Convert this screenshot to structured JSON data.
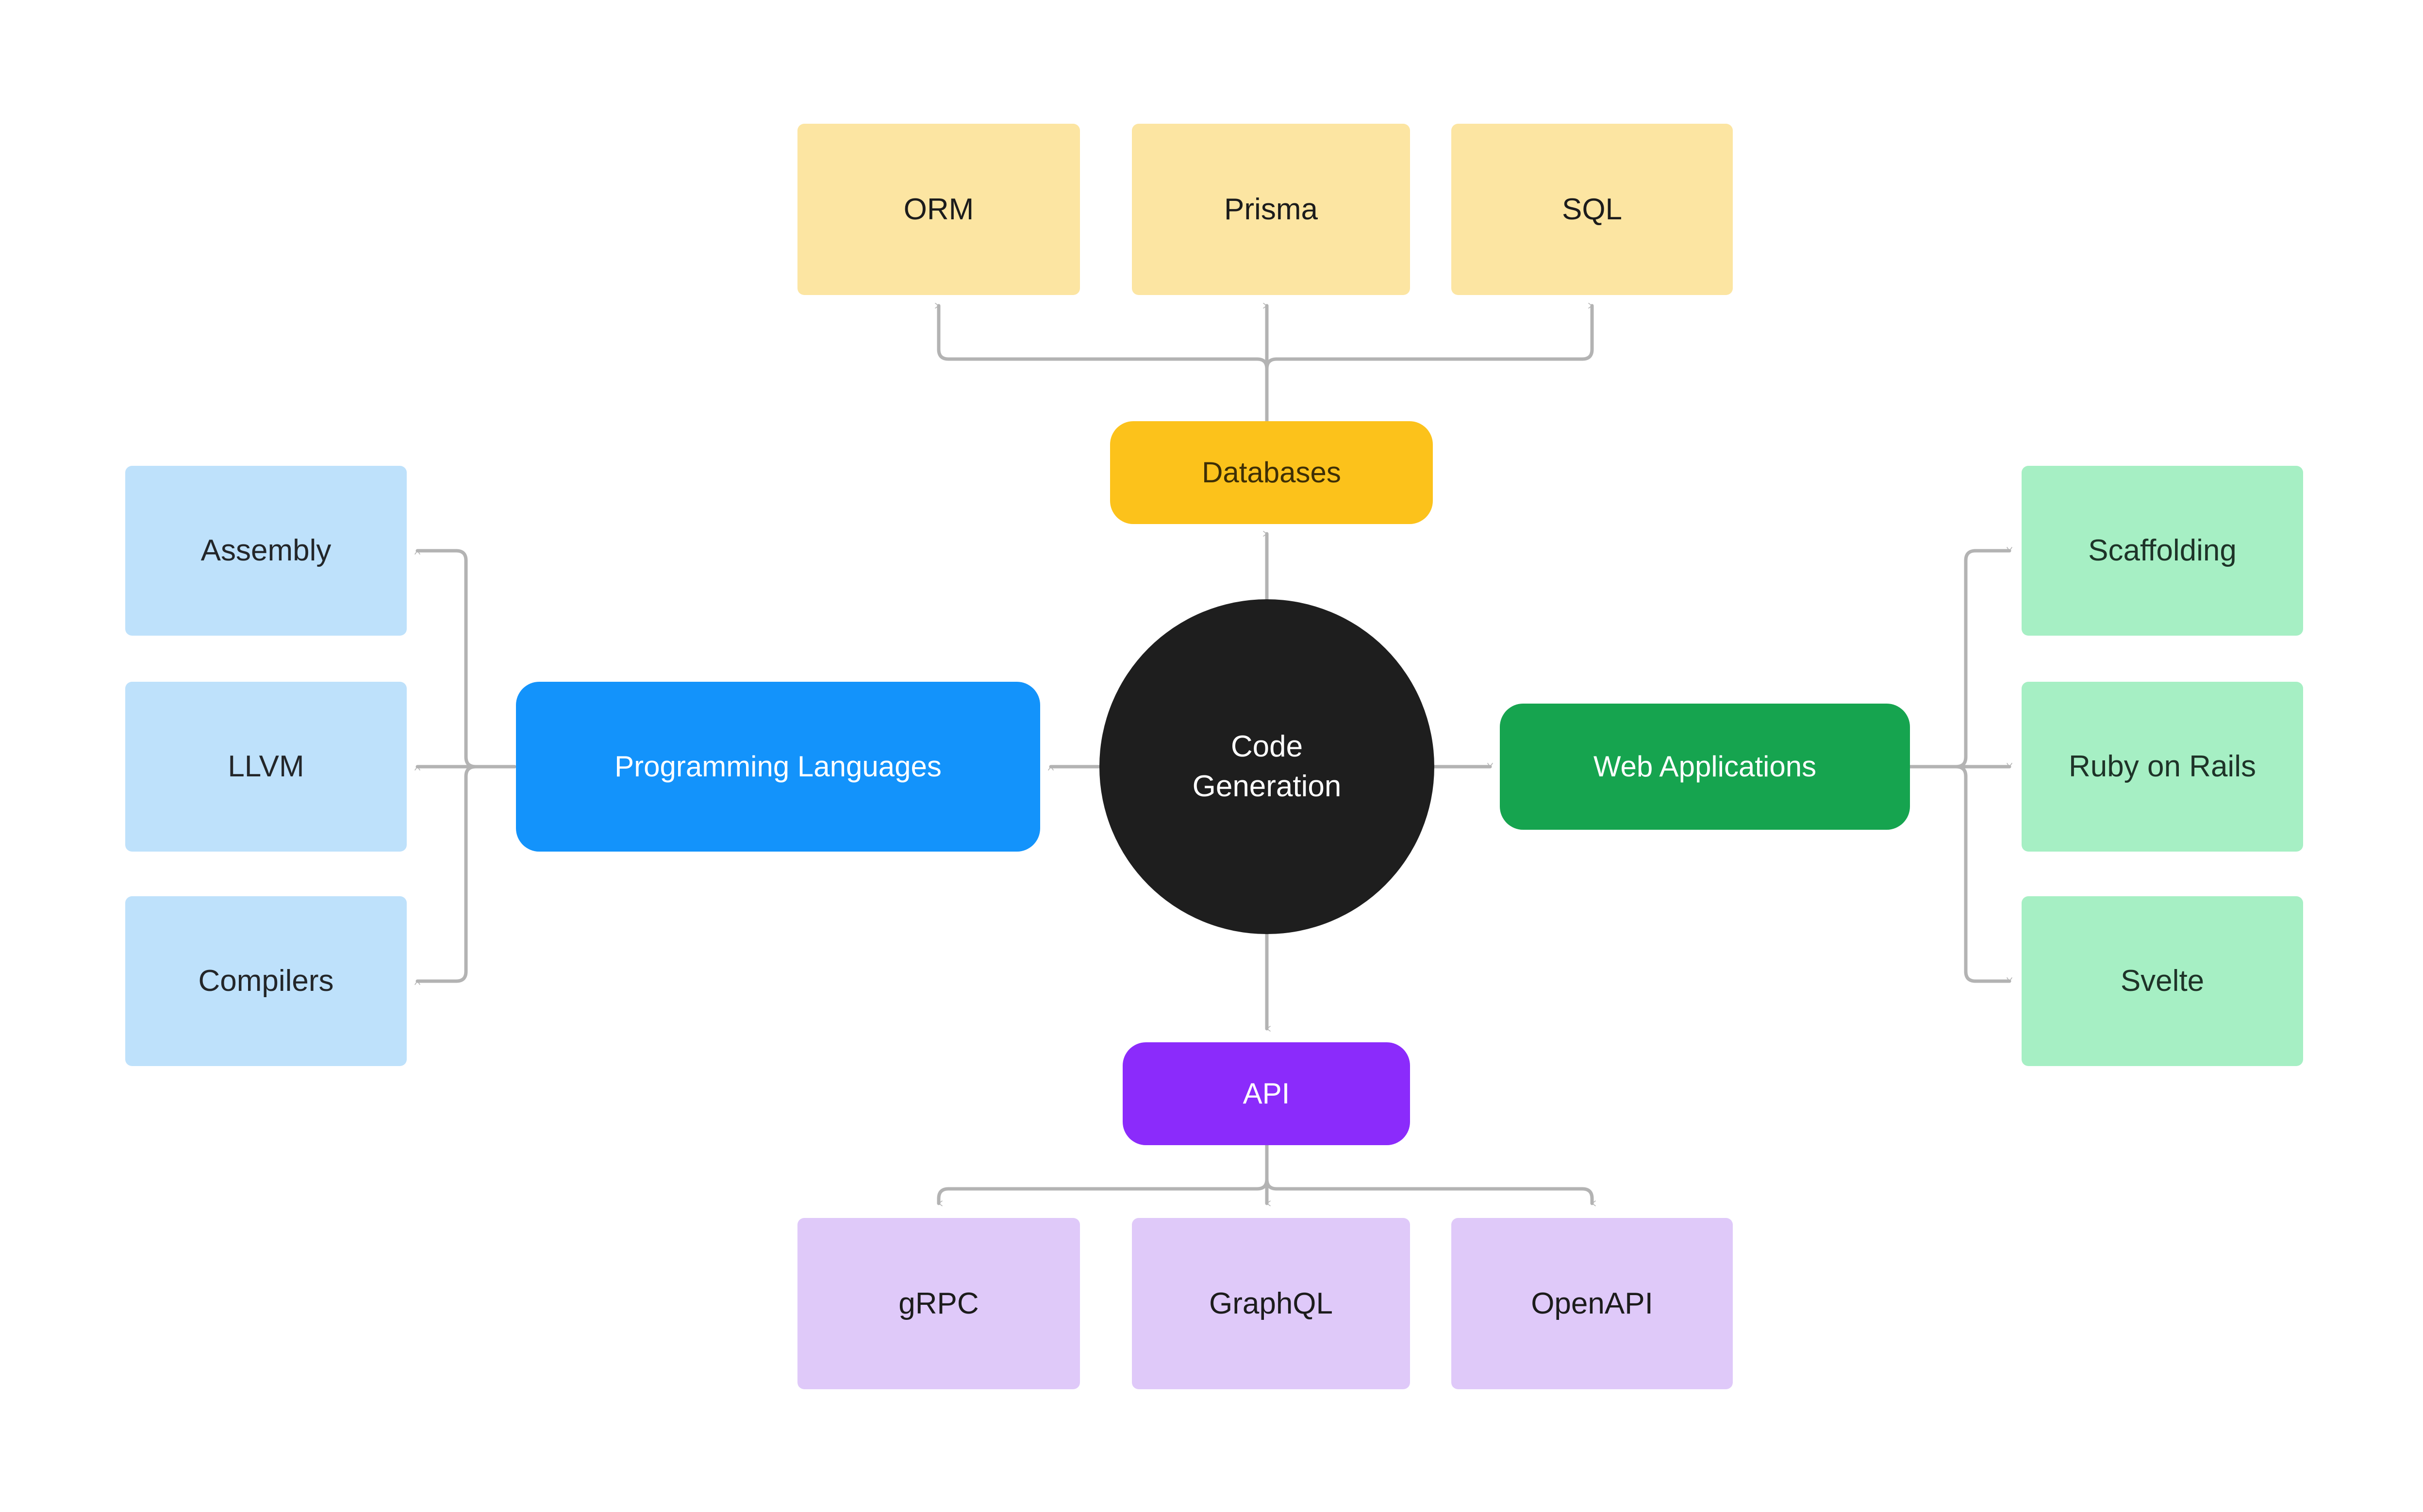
{
  "diagram": {
    "type": "mindmap",
    "title": "Code Generation",
    "background": "#ffffff",
    "edge_color": "#B3B3B3",
    "root": {
      "label_line1": "Code",
      "label_line2": "Generation",
      "shape": "circle",
      "fill": "#1E1E1E",
      "text_color": "#ffffff"
    },
    "branches": [
      {
        "id": "databases",
        "label": "Databases",
        "fill": "#FCC21B",
        "text_color": "#3E2F06",
        "direction": "up",
        "children": [
          {
            "label": "ORM",
            "fill": "#FCE5A2",
            "text_color": "#1C1C1C"
          },
          {
            "label": "Prisma",
            "fill": "#FCE5A2",
            "text_color": "#1C1C1C"
          },
          {
            "label": "SQL",
            "fill": "#FCE5A2",
            "text_color": "#1C1C1C"
          }
        ]
      },
      {
        "id": "programming-languages",
        "label": "Programming Languages",
        "fill": "#1393FB",
        "text_color": "#FFFFFF",
        "direction": "left",
        "children": [
          {
            "label": "Assembly",
            "fill": "#BEE1FB",
            "text_color": "#232629"
          },
          {
            "label": "LLVM",
            "fill": "#BEE1FB",
            "text_color": "#232629"
          },
          {
            "label": "Compilers",
            "fill": "#BEE1FB",
            "text_color": "#232629"
          }
        ]
      },
      {
        "id": "web-applications",
        "label": "Web Applications",
        "fill": "#16A44F",
        "text_color": "#FFFFFF",
        "direction": "right",
        "children": [
          {
            "label": "Scaffolding",
            "fill": "#A6EFC4",
            "text_color": "#1E3328"
          },
          {
            "label": "Ruby on Rails",
            "fill": "#A6EFC4",
            "text_color": "#1E3328"
          },
          {
            "label": "Svelte",
            "fill": "#A6EFC4",
            "text_color": "#1E3328"
          }
        ]
      },
      {
        "id": "api",
        "label": "API",
        "fill": "#8B2BFB",
        "text_color": "#FFFFFF",
        "direction": "down",
        "children": [
          {
            "label": "gRPC",
            "fill": "#DFC9F9",
            "text_color": "#1C1C1C"
          },
          {
            "label": "GraphQL",
            "fill": "#DFC9F9",
            "text_color": "#1C1C1C"
          },
          {
            "label": "OpenAPI",
            "fill": "#DFC9F9",
            "text_color": "#1C1C1C"
          }
        ]
      }
    ]
  }
}
